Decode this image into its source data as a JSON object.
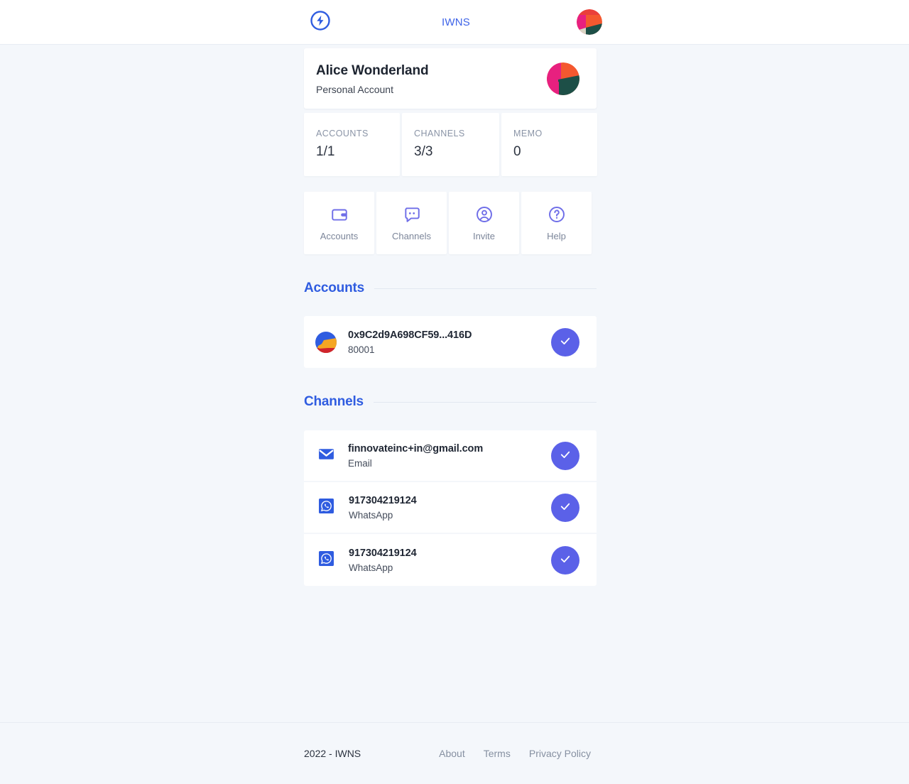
{
  "header": {
    "logo_icon": "lightning-bolt-circle-icon",
    "brand": "IWNS",
    "avatar_icon": "user-identicon-avatar"
  },
  "profile": {
    "name": "Alice Wonderland",
    "subtitle": "Personal Account",
    "avatar_icon": "profile-identicon-avatar"
  },
  "stats": [
    {
      "label": "ACCOUNTS",
      "value": "1/1"
    },
    {
      "label": "CHANNELS",
      "value": "3/3"
    },
    {
      "label": "MEMO",
      "value": "0"
    }
  ],
  "actions": [
    {
      "label": "Accounts",
      "icon": "wallet-icon"
    },
    {
      "label": "Channels",
      "icon": "chat-bubble-icon"
    },
    {
      "label": "Invite",
      "icon": "user-circle-icon"
    },
    {
      "label": "Help",
      "icon": "question-circle-icon"
    }
  ],
  "sections": {
    "accounts_title": "Accounts",
    "channels_title": "Channels"
  },
  "accounts": [
    {
      "address": "0x9C2d9A698CF59...416D",
      "chain": "80001",
      "icon": "account-identicon",
      "verified": true
    }
  ],
  "channels": [
    {
      "value": "finnovateinc+in@gmail.com",
      "type": "Email",
      "icon": "email-icon",
      "verified": true
    },
    {
      "value": "917304219124",
      "type": "WhatsApp",
      "icon": "whatsapp-icon",
      "verified": true
    },
    {
      "value": "917304219124",
      "type": "WhatsApp",
      "icon": "whatsapp-icon",
      "verified": true
    }
  ],
  "footer": {
    "copyright": "2022 - IWNS",
    "links": [
      "About",
      "Terms",
      "Privacy Policy"
    ]
  },
  "colors": {
    "page_background": "#f4f7fb",
    "brand_blue": "#3e63e8",
    "section_blue": "#2f5ce0",
    "action_icon_purple": "#6f6ee8",
    "check_purple": "#5b61e8",
    "email_blue": "#2f5ce0"
  }
}
